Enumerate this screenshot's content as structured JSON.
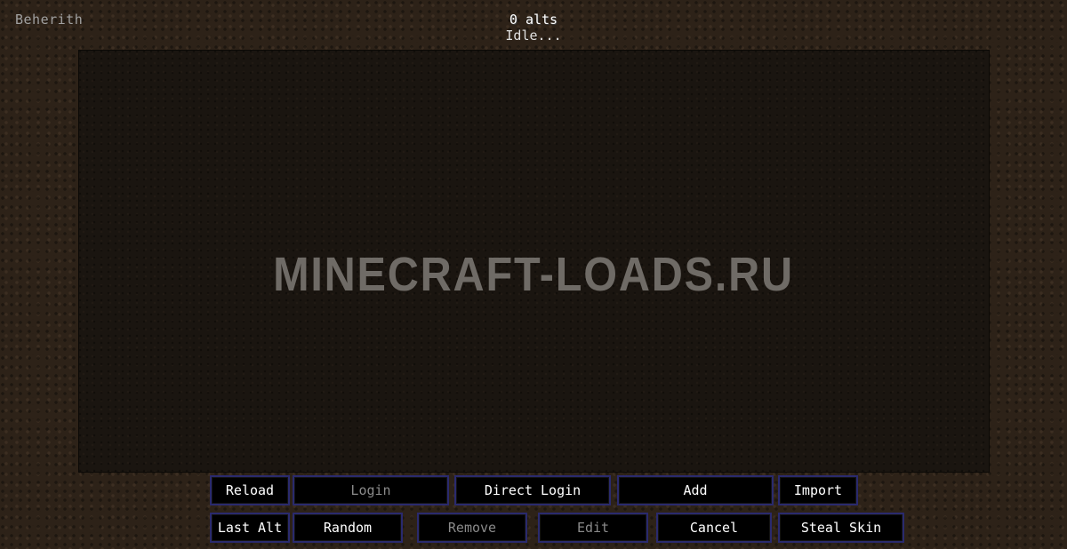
{
  "account": {
    "name": "Beherith"
  },
  "header": {
    "alt_count": "0 alts",
    "status": "Idle..."
  },
  "watermark": {
    "text": "MINECRAFT-LOADS.RU"
  },
  "colors": {
    "button_border": "#2a2a6e",
    "button_bg": "#000000",
    "disabled_text": "#8a8a8a"
  },
  "buttons": {
    "reload": "Reload",
    "login": "Login",
    "direct_login": "Direct Login",
    "add": "Add",
    "import": "Import",
    "last_alt": "Last Alt",
    "random": "Random",
    "remove": "Remove",
    "edit": "Edit",
    "cancel": "Cancel",
    "steal_skin": "Steal Skin"
  }
}
